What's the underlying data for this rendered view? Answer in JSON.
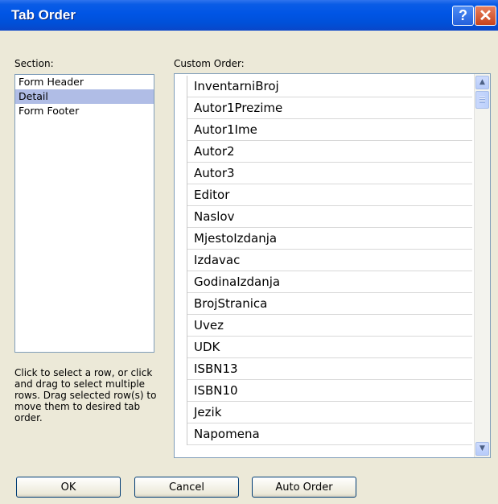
{
  "window": {
    "title": "Tab Order",
    "help_glyph": "?",
    "close_glyph": "✕"
  },
  "section": {
    "label": "Section:",
    "items": [
      "Form Header",
      "Detail",
      "Form Footer"
    ],
    "selected": "Detail"
  },
  "custom_order": {
    "label": "Custom Order:",
    "rows": [
      "InventarniBroj",
      "Autor1Prezime",
      "Autor1Ime",
      "Autor2",
      "Autor3",
      "Editor",
      "Naslov",
      "MjestoIzdanja",
      "Izdavac",
      "GodinaIzdanja",
      "BrojStranica",
      "Uvez",
      "UDK",
      "ISBN13",
      "ISBN10",
      "Jezik",
      "Napomena"
    ]
  },
  "help_text": "Click to select a row, or click and drag to select multiple rows.  Drag selected row(s) to move them to desired tab order.",
  "buttons": {
    "ok": "OK",
    "cancel": "Cancel",
    "auto_order": "Auto Order"
  },
  "colors": {
    "titlebar": "#0055e5",
    "selection": "#b0bde6",
    "dialog_bg": "#ece9d8"
  }
}
